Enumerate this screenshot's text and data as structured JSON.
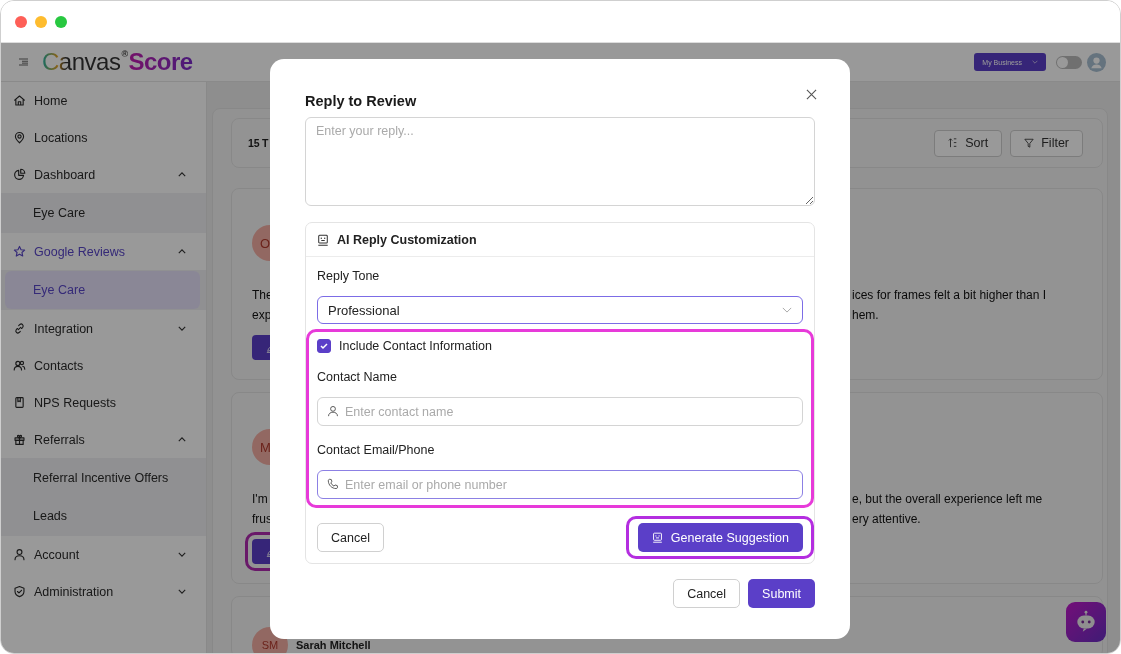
{
  "header": {
    "logo": {
      "name": "Canvas",
      "mark": "®",
      "accent": "Score"
    },
    "business_button": "My Business",
    "theme_toggle": {
      "on": false
    }
  },
  "sidebar": {
    "items": [
      {
        "label": "Home",
        "selected": false
      },
      {
        "label": "Locations",
        "selected": false
      },
      {
        "label": "Dashboard",
        "selected": false,
        "expanded": true,
        "children": [
          {
            "label": "Eye Care",
            "selected": false
          }
        ]
      },
      {
        "label": "Google Reviews",
        "selected": true,
        "expanded": true,
        "children": [
          {
            "label": "Eye Care",
            "selected": true
          }
        ]
      },
      {
        "label": "Integration",
        "selected": false,
        "expanded": false
      },
      {
        "label": "Contacts",
        "selected": false
      },
      {
        "label": "NPS Requests",
        "selected": false
      },
      {
        "label": "Referrals",
        "selected": false,
        "expanded": true,
        "children": [
          {
            "label": "Referral Incentive Offers",
            "selected": false
          },
          {
            "label": "Leads",
            "selected": false
          }
        ]
      },
      {
        "label": "Account",
        "selected": false,
        "expanded": false
      },
      {
        "label": "Administration",
        "selected": false,
        "expanded": false
      }
    ]
  },
  "toolbar": {
    "count": "15 T",
    "sort": "Sort",
    "filter": "Filter"
  },
  "reviews": [
    {
      "avatar": "O",
      "left": [
        "The",
        "exp"
      ],
      "right": [
        "ices for frames felt a bit higher than I",
        "hem."
      ],
      "highlighted": false
    },
    {
      "avatar": "M",
      "left": [
        "I'm",
        "frus"
      ],
      "right": [
        "e, but the overall experience left me",
        "ery attentive."
      ],
      "highlighted": true
    },
    {
      "avatar": "SM",
      "name": "Sarah Mitchell"
    }
  ],
  "modal": {
    "title": "Reply to Review",
    "reply": {
      "placeholder": "Enter your reply..."
    },
    "ai": {
      "title": "AI Reply Customization",
      "tone_label": "Reply Tone",
      "tone_value": "Professional",
      "contact": {
        "highlighted": true,
        "include": {
          "label": "Include Contact Information",
          "checked": true
        },
        "name": {
          "label": "Contact Name",
          "placeholder": "Enter contact name"
        },
        "email": {
          "label": "Contact Email/Phone",
          "placeholder": "Enter email or phone number",
          "focused": true
        }
      },
      "cancel": "Cancel",
      "generate": {
        "label": "Generate Suggestion",
        "highlighted": true
      }
    },
    "buttons": [
      "Cancel",
      "Submit"
    ]
  }
}
